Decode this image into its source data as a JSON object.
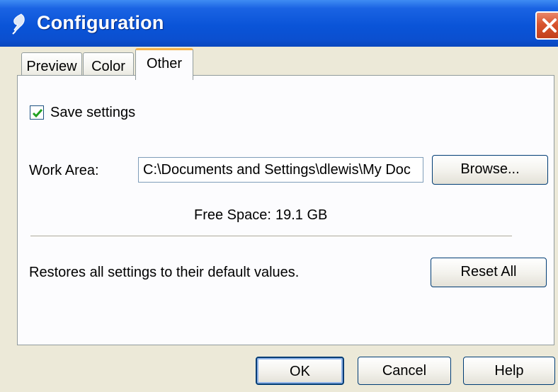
{
  "window": {
    "title": "Configuration",
    "icon": "feather-icon",
    "close_icon": "close-icon"
  },
  "tabs": [
    {
      "label": "Preview",
      "active": false
    },
    {
      "label": "Color",
      "active": false
    },
    {
      "label": "Other",
      "active": true
    }
  ],
  "other_tab": {
    "save_settings": {
      "label": "Save settings",
      "checked": true
    },
    "work_area": {
      "label": "Work Area:",
      "value": "C:\\Documents and Settings\\dlewis\\My Doc"
    },
    "browse_label": "Browse...",
    "free_space": {
      "label": "Free Space:",
      "value": "19.1 GB"
    },
    "restore_text": "Restores all settings to their default values.",
    "reset_label": "Reset All"
  },
  "footer": {
    "ok_label": "OK",
    "cancel_label": "Cancel",
    "help_label": "Help"
  },
  "colors": {
    "titlebar": "#0a54d8",
    "close_button": "#d8542e",
    "active_tab_accent": "#f5b34a",
    "dialog_background": "#ece9d8"
  }
}
